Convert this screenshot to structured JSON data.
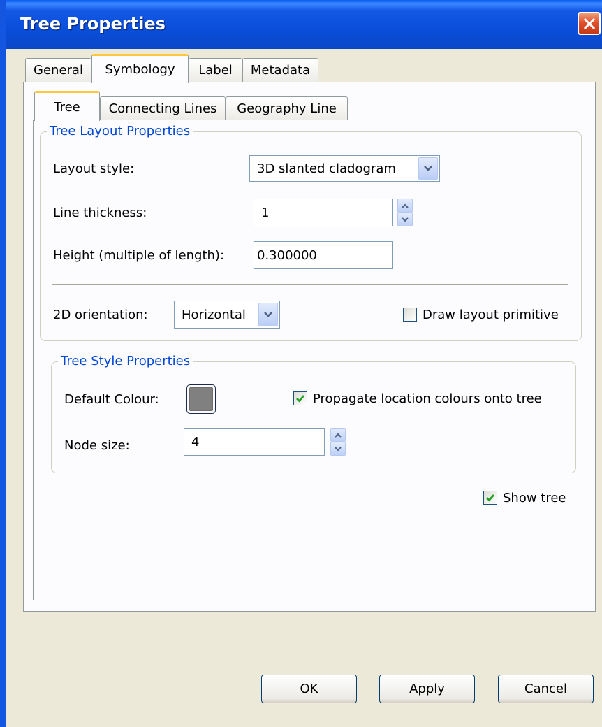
{
  "window": {
    "title": "Tree Properties"
  },
  "outer_tabs": [
    {
      "label": "General"
    },
    {
      "label": "Symbology",
      "active": true
    },
    {
      "label": "Label"
    },
    {
      "label": "Metadata"
    }
  ],
  "inner_tabs": [
    {
      "label": "Tree",
      "active": true
    },
    {
      "label": "Connecting Lines"
    },
    {
      "label": "Geography Line"
    }
  ],
  "layout_group": {
    "title": "Tree Layout Properties",
    "layout_style_label": "Layout style:",
    "layout_style_value": "3D slanted cladogram",
    "line_thickness_label": "Line thickness:",
    "line_thickness_value": "1",
    "height_label": "Height (multiple of length):",
    "height_value": "0.300000",
    "orientation_label": "2D orientation:",
    "orientation_value": "Horizontal",
    "draw_primitive_label": "Draw layout primitive",
    "draw_primitive_checked": false
  },
  "style_group": {
    "title": "Tree Style Properties",
    "default_colour_label": "Default Colour:",
    "default_colour": "#808080",
    "propagate_label": "Propagate location colours onto tree",
    "propagate_checked": true,
    "node_size_label": "Node size:",
    "node_size_value": "4"
  },
  "show_tree": {
    "label": "Show tree",
    "checked": true
  },
  "buttons": {
    "ok": "OK",
    "apply": "Apply",
    "cancel": "Cancel"
  },
  "icons": {
    "close": "close-icon",
    "dropdown": "chevron-down-icon",
    "spin_up": "chevron-up-icon",
    "spin_down": "chevron-down-icon",
    "check": "checkmark-icon"
  }
}
